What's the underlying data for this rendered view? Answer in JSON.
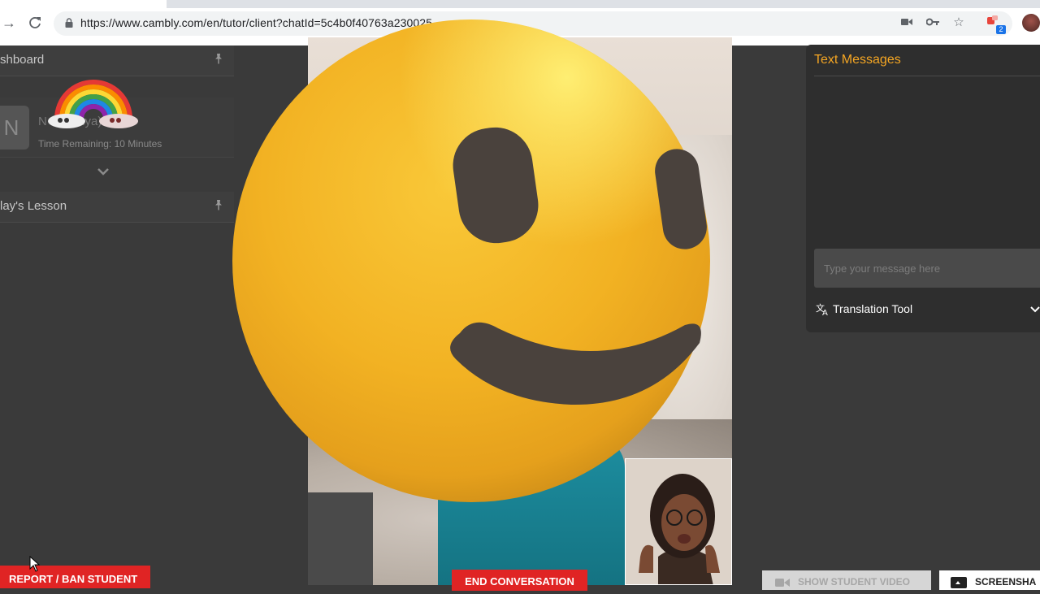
{
  "browser": {
    "url": "https://www.cambly.com/en/tutor/client?chatId=5c4b0f40763a230025",
    "extension_badge": "2"
  },
  "left_panel": {
    "dashboard_header": "shboard",
    "student": {
      "avatar_initial": "N",
      "name": "N      ality     aiya)",
      "time_remaining": "Time Remaining: 10 Minutes"
    },
    "lesson_header": "lay's Lesson",
    "report_button": "REPORT / BAN STUDENT"
  },
  "video": {
    "end_button": "END CONVERSATION"
  },
  "right_panel": {
    "title": "Text Messages",
    "message_placeholder": "Type your message here",
    "translation_label": "Translation Tool"
  },
  "bottom_buttons": {
    "show_student_video": "SHOW STUDENT VIDEO",
    "screenshot": "SCREENSHA"
  },
  "colors": {
    "accent_orange": "#f5a623",
    "danger_red": "#e02424",
    "panel_dark": "#2e2e2e"
  }
}
